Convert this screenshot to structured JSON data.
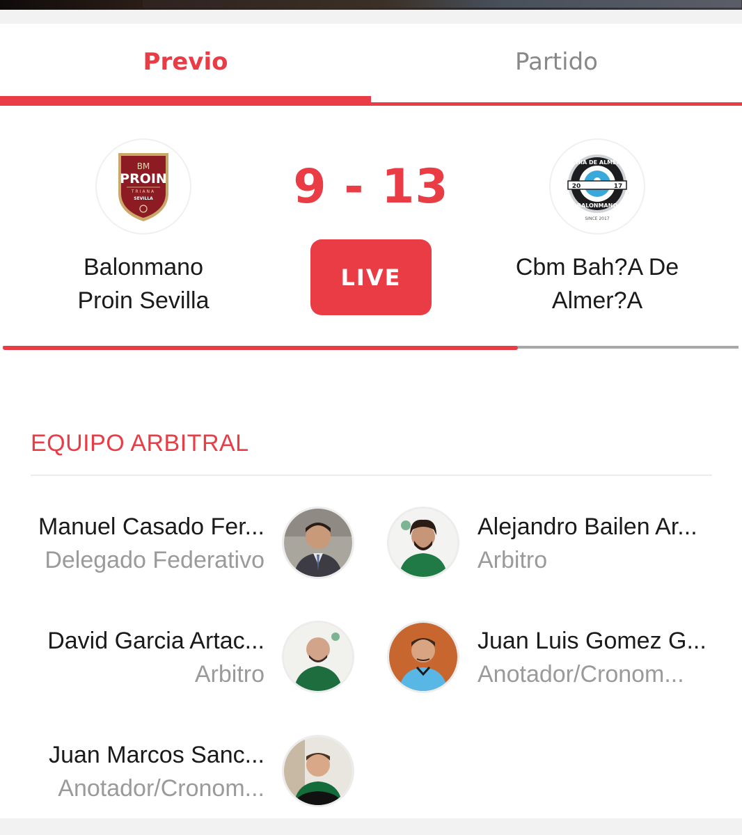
{
  "tabs": [
    {
      "label": "Previo",
      "active": true
    },
    {
      "label": "Partido",
      "active": false
    }
  ],
  "match": {
    "home_team": "Balonmano Proin Sevilla",
    "away_team": "Cbm Bah?A De Almer?A",
    "score": "9 - 13",
    "live_label": "LIVE",
    "progress_fraction": 0.7,
    "home_logo": {
      "line1": "BM",
      "line2": "PROIN",
      "line3": "TRIANA",
      "line4": "SEVILLA"
    },
    "away_logo": {
      "arc_top": "BAHIA DE ALMERIA",
      "arc_bottom": "BALONMANO",
      "year_left": "20",
      "year_right": "17",
      "since": "SINCE 2017"
    }
  },
  "referees": {
    "title": "EQUIPO ARBITRAL",
    "items": [
      {
        "name": "Manuel Casado Fer...",
        "role": "Delegado Federativo",
        "avatar_icon": "person-avatar-suit"
      },
      {
        "name": "Alejandro Bailen Ar...",
        "role": "Arbitro",
        "avatar_icon": "person-avatar-green-shirt"
      },
      {
        "name": "David Garcia Artac...",
        "role": "Arbitro",
        "avatar_icon": "person-avatar-green-shirt"
      },
      {
        "name": "Juan Luis Gomez G...",
        "role": "Anotador/Cronom...",
        "avatar_icon": "person-avatar-blue-shirt"
      },
      {
        "name": "Juan Marcos Sanc...",
        "role": "Anotador/Cronom...",
        "avatar_icon": "person-avatar-green-shirt"
      }
    ]
  },
  "colors": {
    "accent": "#ea3c45",
    "text": "#1a1a1a",
    "muted": "#9a9a9a",
    "background": "#f2f2f2"
  }
}
